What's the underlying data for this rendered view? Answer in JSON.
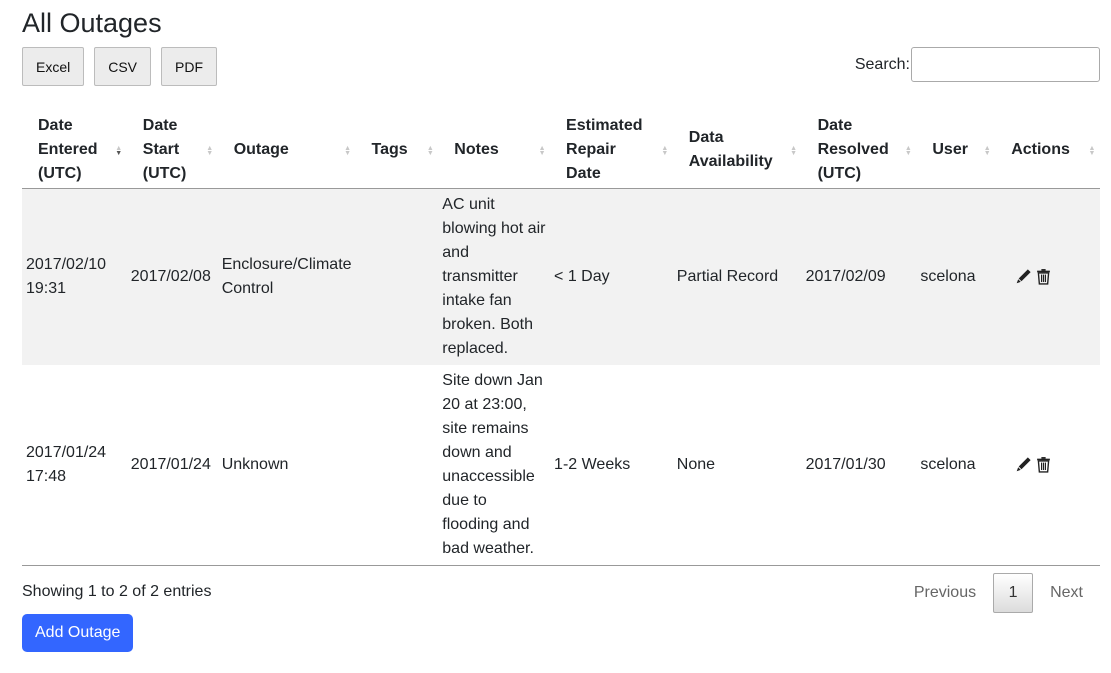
{
  "page": {
    "title": "All Outages"
  },
  "toolbar": {
    "excel_label": "Excel",
    "csv_label": "CSV",
    "pdf_label": "PDF"
  },
  "search": {
    "label": "Search:",
    "value": ""
  },
  "table": {
    "columns": [
      "Date Entered (UTC)",
      "Date Start (UTC)",
      "Outage",
      "Tags",
      "Notes",
      "Estimated Repair Date",
      "Data Availability",
      "Date Resolved (UTC)",
      "User",
      "Actions"
    ],
    "sorted_column": "Date Entered (UTC)",
    "sort_direction": "descending",
    "rows": [
      {
        "date_entered": "2017/02/10 19:31",
        "date_start": "2017/02/08",
        "outage": "Enclosure/Climate Control",
        "tags": "",
        "notes": "AC unit blowing hot air and transmitter intake fan broken. Both replaced.",
        "estimated_repair": "< 1 Day",
        "data_availability": "Partial Record",
        "date_resolved": "2017/02/09",
        "user": "scelona",
        "actions": [
          "pencil-icon",
          "trash-icon"
        ]
      },
      {
        "date_entered": "2017/01/24 17:48",
        "date_start": "2017/01/24",
        "outage": "Unknown",
        "tags": "",
        "notes": "Site down Jan 20 at 23:00, site remains down and unaccessible due to flooding and bad weather.",
        "estimated_repair": "1-2 Weeks",
        "data_availability": "None",
        "date_resolved": "2017/01/30",
        "user": "scelona",
        "actions": [
          "pencil-icon",
          "trash-icon"
        ]
      }
    ]
  },
  "footer": {
    "info": "Showing 1 to 2 of 2 entries"
  },
  "pagination": {
    "previous": "Previous",
    "current": "1",
    "next": "Next"
  },
  "add_button": {
    "label": "Add Outage"
  },
  "colors": {
    "accent": "#3366ff",
    "row_stripe": "#f2f2f2"
  }
}
